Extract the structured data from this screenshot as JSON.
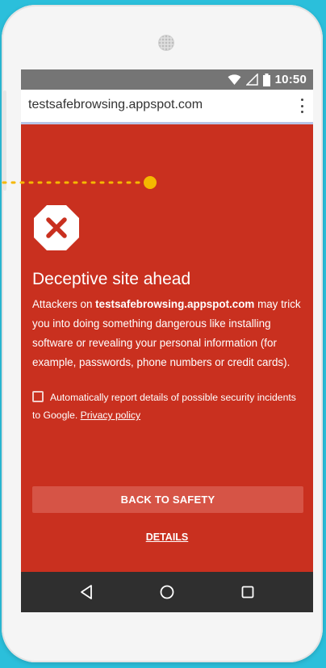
{
  "status_bar": {
    "time": "10:50",
    "icons": [
      "wifi-icon",
      "signal-icon",
      "battery-icon"
    ]
  },
  "url_bar": {
    "url": "testsafebrowsing.appspot.com",
    "menu_icon": "more-vert-icon"
  },
  "interstitial": {
    "icon": "stop-sign-x-icon",
    "heading": "Deceptive site ahead",
    "message_prefix": "Attackers on ",
    "message_domain": "testsafebrowsing.appspot.com",
    "message_suffix": " may trick you into doing something dangerous like installing software or revealing your personal information (for example, passwords, phone numbers or credit cards).",
    "report_checkbox": {
      "checked": false,
      "label": "Automatically report details of possible security incidents to Google. ",
      "link": "Privacy policy"
    },
    "primary_button": "BACK TO SAFETY",
    "details_link": "DETAILS"
  },
  "nav_bar": {
    "buttons": [
      "back-icon",
      "home-icon",
      "recents-icon"
    ]
  },
  "colors": {
    "background": "#2bbfdb",
    "interstitial": "#c9301f",
    "button": "#d65446",
    "status_bar": "#757575",
    "nav_bar": "#2f2f2f",
    "annotation": "#f5b800"
  }
}
